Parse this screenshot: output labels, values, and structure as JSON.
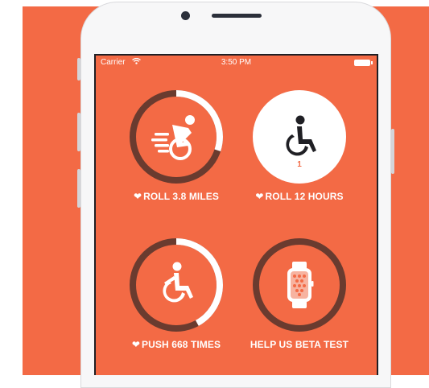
{
  "colors": {
    "accent": "#f36a45",
    "ring_track": "#6a3b2f",
    "ring_progress": "#ffffff",
    "icon_fill": "#ffffff",
    "white_circle": "#ffffff",
    "white_circle_icon": "#1f1f24",
    "small_count": "#f36a45"
  },
  "status_bar": {
    "carrier": "Carrier",
    "wifi_icon": "wifi-icon",
    "time": "3:50 PM",
    "battery_icon": "battery-icon"
  },
  "goals": [
    {
      "label_heart": "❤",
      "label": "ROLL 3.8 MILES",
      "icon": "fast-wheelchair-icon",
      "progress": 0.3,
      "style": "ring"
    },
    {
      "label_heart": "❤",
      "label": "ROLL 12 HOURS",
      "icon": "wheelchair-icon",
      "count": "1",
      "style": "filled"
    },
    {
      "label_heart": "❤",
      "label": "PUSH 668 TIMES",
      "icon": "wheelchair-push-icon",
      "progress": 0.42,
      "style": "ring"
    },
    {
      "label": "HELP US BETA TEST",
      "icon": "smartwatch-icon",
      "progress": 0.0,
      "style": "ring"
    }
  ]
}
